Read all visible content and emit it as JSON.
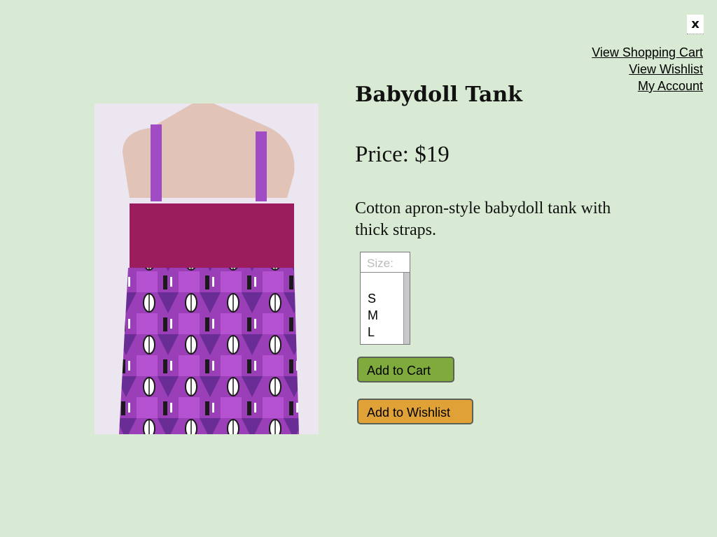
{
  "header": {
    "close_label": "x",
    "links": [
      {
        "label": "View Shopping Cart"
      },
      {
        "label": "View Wishlist"
      },
      {
        "label": "My Account"
      }
    ]
  },
  "product": {
    "title": "Babydoll Tank",
    "price_label": "Price: $19",
    "description": "Cotton apron-style babydoll tank with thick straps.",
    "image_icon": "product-photo",
    "size": {
      "placeholder": "Size:",
      "options": [
        "S",
        "M",
        "L"
      ]
    },
    "add_to_cart_label": "Add to Cart",
    "add_to_wishlist_label": "Add to Wishlist"
  },
  "colors": {
    "background": "#d8ead3",
    "add_to_cart": "#7fab3d",
    "add_to_wishlist": "#e0a136"
  }
}
